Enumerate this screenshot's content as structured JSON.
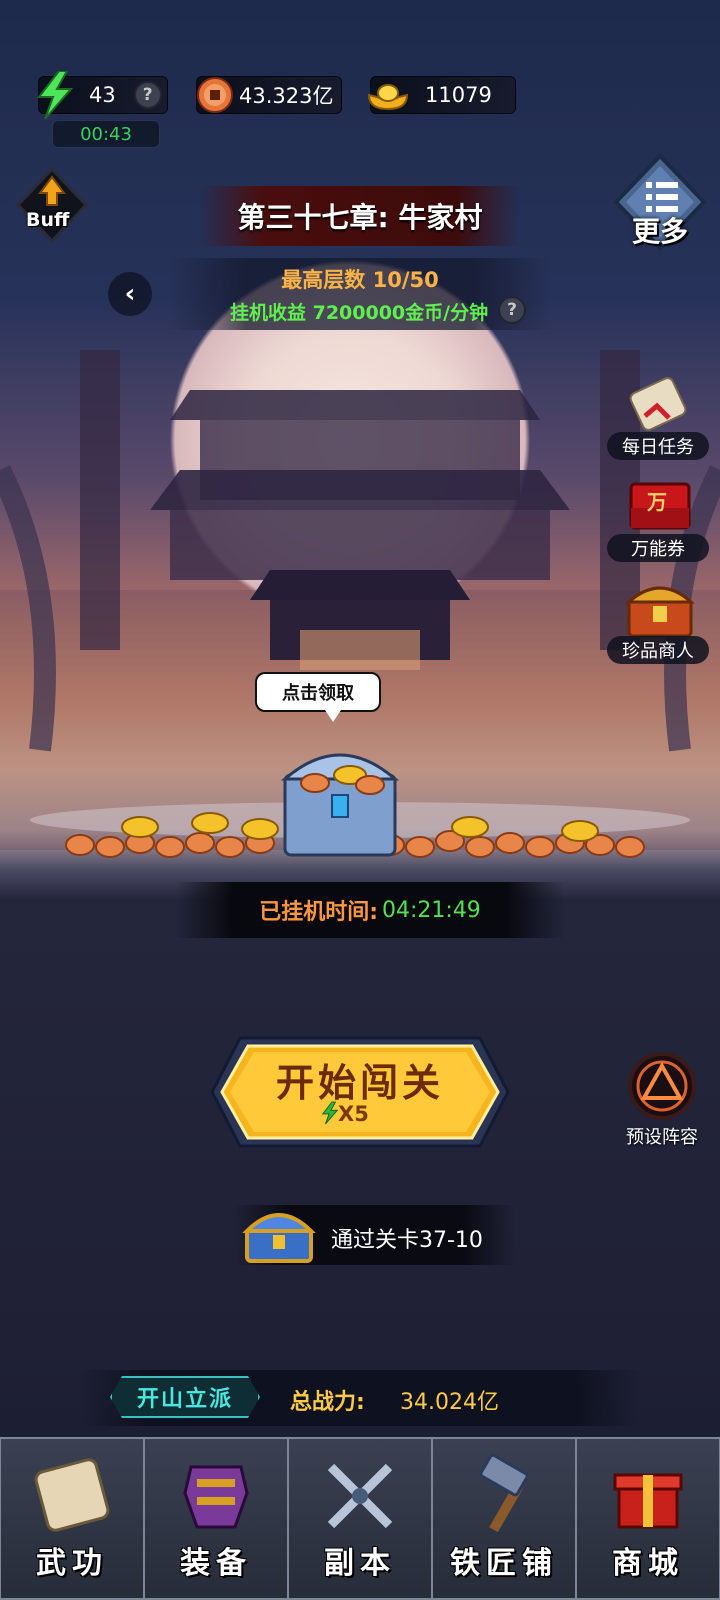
{
  "resources": {
    "energy": "43",
    "energy_timer": "00:43",
    "copper_coins": "43.323亿",
    "gold_ingots": "11079"
  },
  "buttons": {
    "buff": "Buff",
    "more": "更多"
  },
  "chapter": {
    "title": "第三十七章: 牛家村",
    "max_floor": "最高层数 10/50",
    "idle_income": "挂机收益 7200000金币/分钟"
  },
  "side_menu": {
    "daily_tasks": "每日任务",
    "universal_coupon": "万能券",
    "universal_coupon_badge": "万",
    "treasure_merchant": "珍品商人"
  },
  "chest": {
    "bubble_text": "点击领取",
    "idle_time_label": "已挂机时间:",
    "idle_time_value": "04:21:49"
  },
  "battle": {
    "start_label": "开始闯关",
    "cost": "X5",
    "formation": "预设阵容",
    "next_reward": "通过关卡37-10"
  },
  "power": {
    "sect_button": "开山立派",
    "label": "总战力:",
    "value": "34.024亿"
  },
  "nav": [
    {
      "label": "武功"
    },
    {
      "label": "装备"
    },
    {
      "label": "副本"
    },
    {
      "label": "铁匠铺"
    },
    {
      "label": "商城"
    }
  ],
  "colors": {
    "energy_green": "#39d158",
    "income_green": "#5ff04f",
    "floor_orange": "#ffb347",
    "power_gold": "#ffc94a",
    "sect_cyan": "#48e8e0"
  }
}
